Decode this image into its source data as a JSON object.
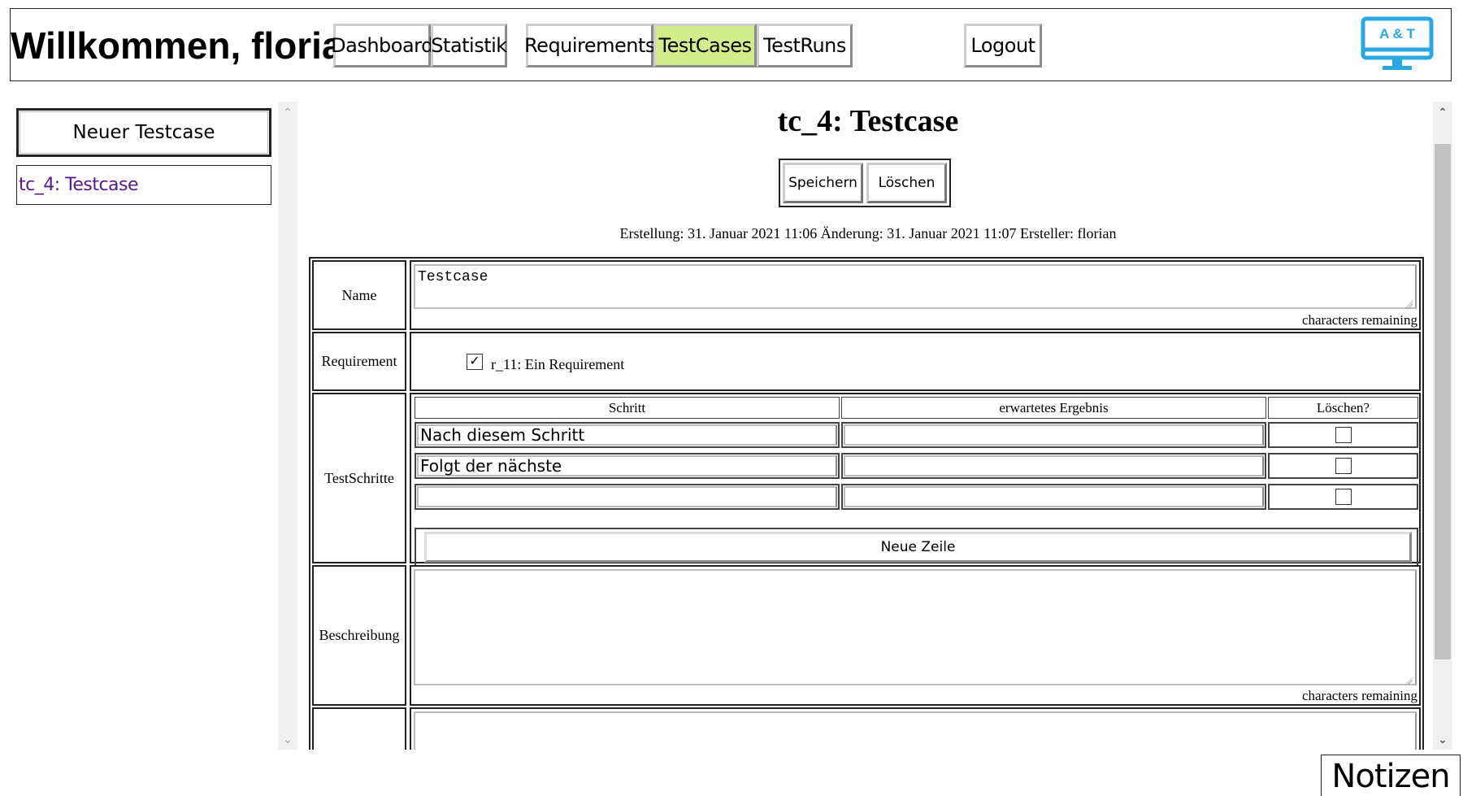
{
  "header": {
    "welcome": "Willkommen, florian",
    "nav": {
      "dashboard": "Dashboard",
      "statistik": "Statistik",
      "requirements": "Requirements",
      "testcases": "TestCases",
      "testruns": "TestRuns",
      "logout": "Logout"
    },
    "active_tab": "TestCases",
    "active_color": "#d3ed8c",
    "logo_text": "A & T",
    "logo_color": "#2aa7e0"
  },
  "sidebar": {
    "new_button": "Neuer Testcase",
    "items": [
      "tc_4: Testcase"
    ]
  },
  "main": {
    "title": "tc_4: Testcase",
    "save": "Speichern",
    "delete": "Löschen",
    "meta": "Erstellung: 31. Januar 2021 11:06 Änderung: 31. Januar 2021 11:07 Ersteller: florian",
    "form": {
      "name_label": "Name",
      "name_value": "Testcase",
      "chars_remaining": "characters remaining",
      "requirement_label": "Requirement",
      "requirement_item": "r_11: Ein Requirement",
      "requirement_checked": true,
      "steps_label": "TestSchritte",
      "steps_headers": {
        "step": "Schritt",
        "expected": "erwartetes Ergebnis",
        "delete": "Löschen?"
      },
      "steps": [
        {
          "step": "Nach diesem Schritt",
          "expected": "",
          "delete": false
        },
        {
          "step": "Folgt der nächste",
          "expected": "",
          "delete": false
        },
        {
          "step": "",
          "expected": "",
          "delete": false
        }
      ],
      "add_row": "Neue Zeile",
      "description_label": "Beschreibung",
      "description_value": ""
    }
  },
  "notes_button": "Notizen"
}
